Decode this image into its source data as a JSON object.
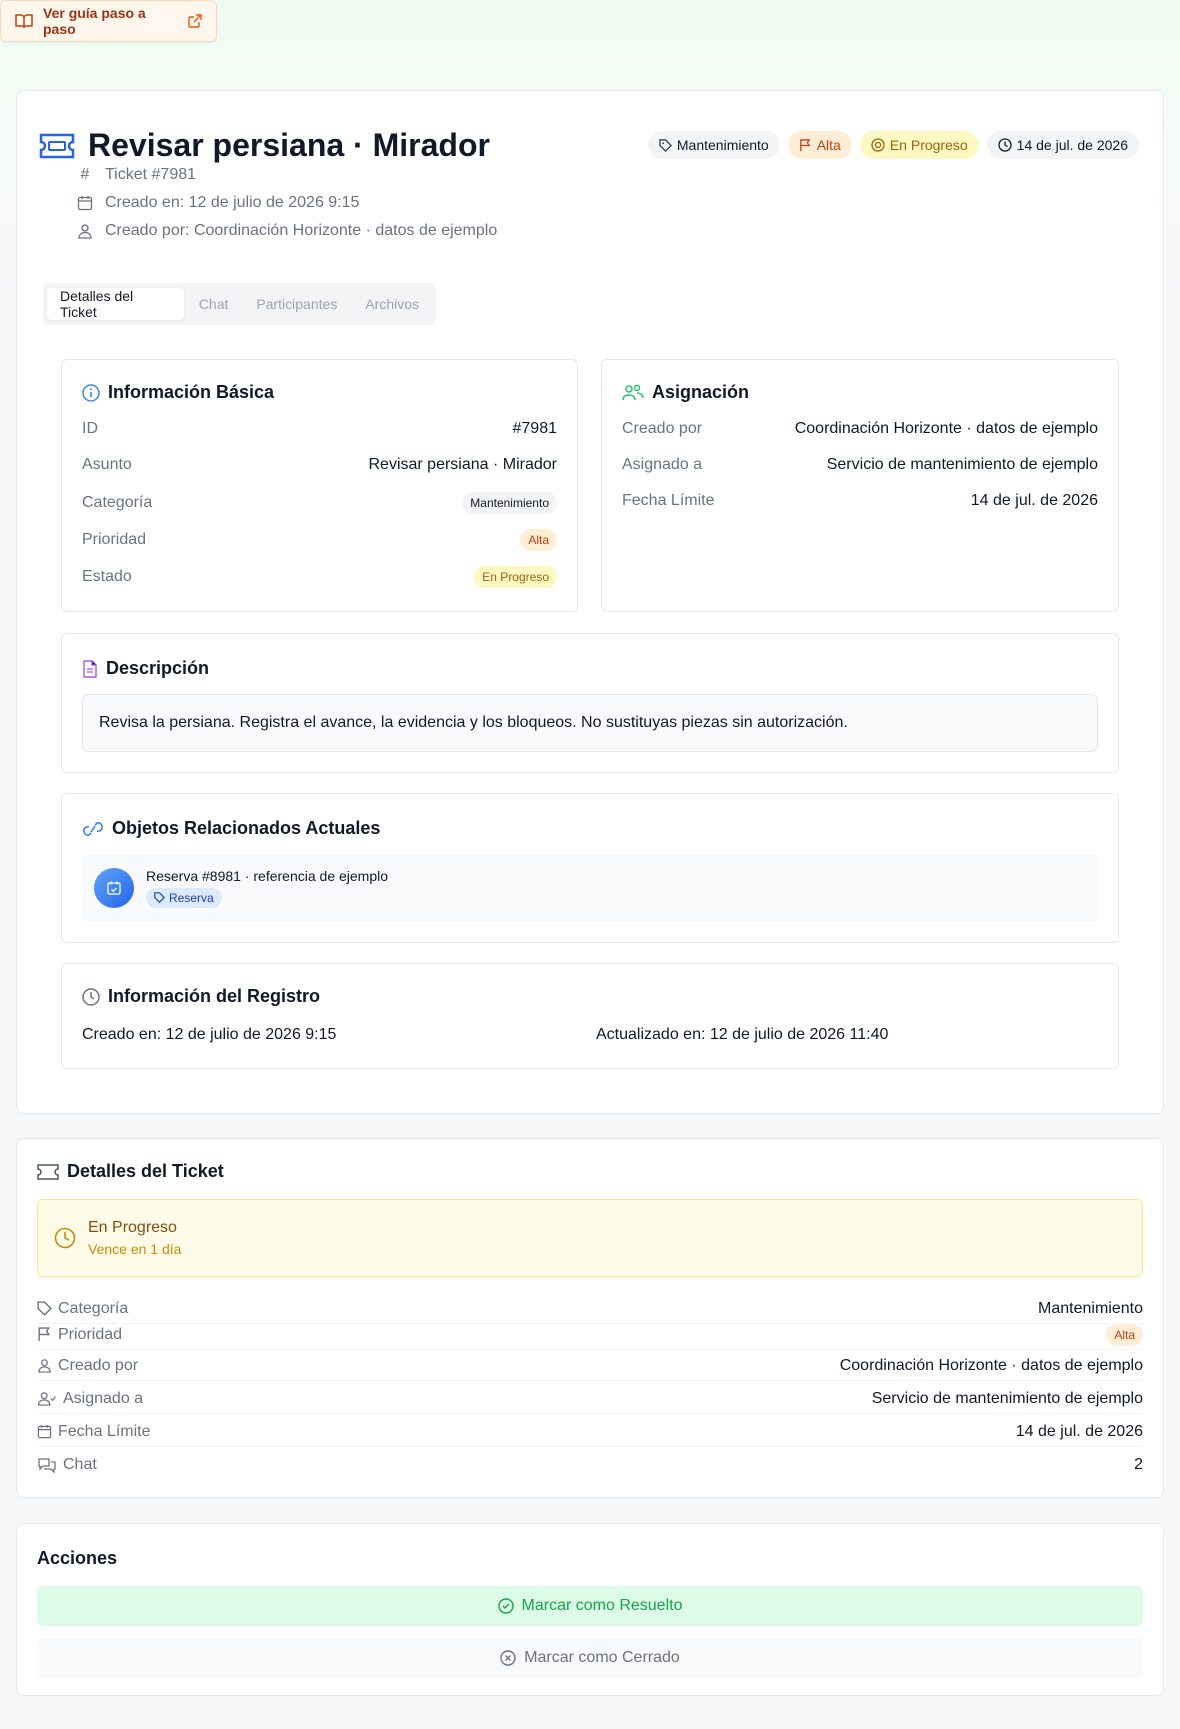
{
  "guide_button": {
    "label": "Ver guía paso a paso",
    "icon": "book-icon",
    "external_icon": "external-link-icon"
  },
  "header": {
    "title": "Revisar persiana · Mirador",
    "chips": {
      "category": "Mantenimiento",
      "priority": "Alta",
      "status": "En Progreso",
      "due": "14 de jul. de 2026"
    },
    "meta": {
      "ticket": "Ticket #7981",
      "created_at": "Creado en: 12 de julio de 2026 9:15",
      "created_by": "Creado por: Coordinación Horizonte · datos de ejemplo"
    }
  },
  "tabs": [
    "Detalles del Ticket",
    "Chat",
    "Participantes",
    "Archivos"
  ],
  "basic_info": {
    "title": "Información Básica",
    "rows": [
      {
        "k": "ID",
        "v": "#7981"
      },
      {
        "k": "Asunto",
        "v": "Revisar persiana · Mirador"
      },
      {
        "k": "Categoría",
        "v": "Mantenimiento"
      },
      {
        "k": "Prioridad",
        "v": "Alta"
      },
      {
        "k": "Estado",
        "v": "En Progreso"
      }
    ]
  },
  "assignment": {
    "title": "Asignación",
    "rows": [
      {
        "k": "Creado por",
        "v": "Coordinación Horizonte · datos de ejemplo"
      },
      {
        "k": "Asignado a",
        "v": "Servicio de mantenimiento de ejemplo"
      },
      {
        "k": "Fecha Límite",
        "v": "14 de jul. de 2026"
      }
    ]
  },
  "description": {
    "title": "Descripción",
    "text": "Revisa la persiana. Registra el avance, la evidencia y los bloqueos. No sustituyas piezas sin autorización."
  },
  "related": {
    "title": "Objetos Relacionados Actuales",
    "item": "Reserva #8981 · referencia de ejemplo",
    "tag": "Reserva"
  },
  "registry": {
    "title": "Información del Registro",
    "created": "Creado en: 12 de julio de 2026 9:15",
    "updated": "Actualizado en: 12 de julio de 2026 11:40"
  },
  "details": {
    "title": "Detalles del Ticket",
    "status": "En Progreso",
    "due_note": "Vence en 1 día",
    "rows": [
      {
        "k": "Categoría",
        "v": "Mantenimiento"
      },
      {
        "k": "Prioridad",
        "v": "Alta"
      },
      {
        "k": "Creado por",
        "v": "Coordinación Horizonte · datos de ejemplo"
      },
      {
        "k": "Asignado a",
        "v": "Servicio de mantenimiento de ejemplo"
      },
      {
        "k": "Fecha Límite",
        "v": "14 de jul. de 2026"
      },
      {
        "k": "Chat",
        "v": "2"
      }
    ]
  },
  "actions": {
    "title": "Acciones",
    "resolve": "Marcar como Resuelto",
    "close": "Marcar como Cerrado"
  }
}
